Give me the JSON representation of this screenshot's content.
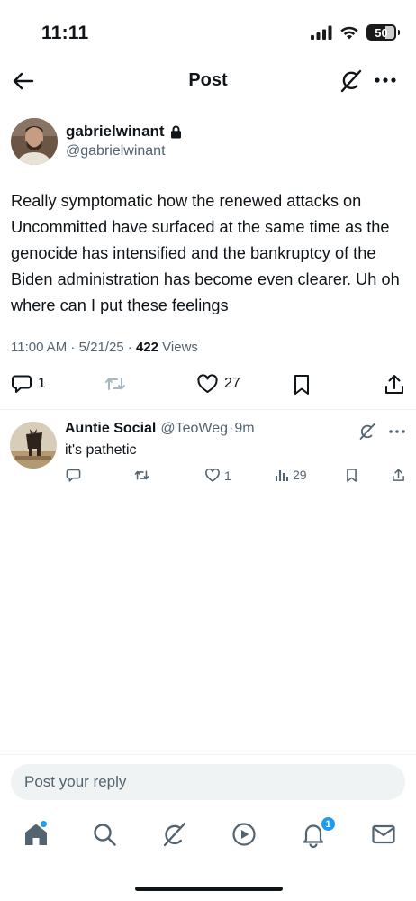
{
  "status_bar": {
    "time": "11:11",
    "battery": "50"
  },
  "header": {
    "title": "Post"
  },
  "post": {
    "author_name": "gabrielwinant",
    "author_handle": "@gabrielwinant",
    "text": "Really symptomatic how the renewed attacks on Uncommitted have surfaced at the same time as the genocide has intensified and the bankruptcy of the Biden administration has become even clearer. Uh oh where can I put these feelings",
    "timestamp": "11:00 AM · 5/21/25 · ",
    "views_count": "422",
    "views_label": " Views",
    "replies": "1",
    "likes": "27"
  },
  "reply": {
    "author_name": "Auntie Social",
    "author_handle": "@TeoWeg",
    "separator": "·",
    "time": "9m",
    "text": "it's pathetic",
    "likes": "1",
    "views": "29"
  },
  "composer": {
    "placeholder": "Post your reply"
  },
  "nav": {
    "notification_count": "1"
  },
  "colors": {
    "accent": "#1d9bf0",
    "text": "#0f1419",
    "secondary": "#536471",
    "divider": "#eff3f4"
  }
}
